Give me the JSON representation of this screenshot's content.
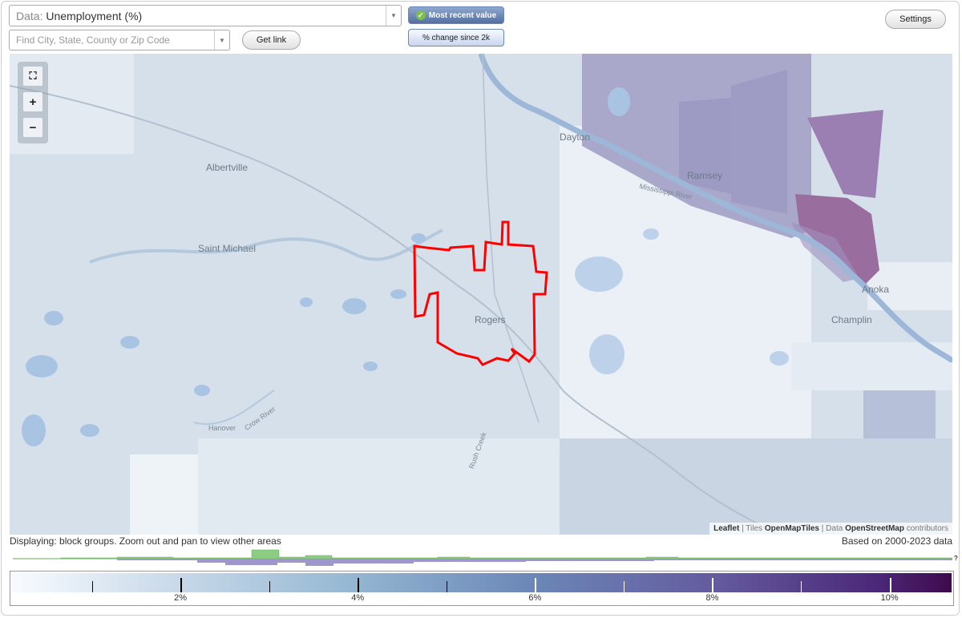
{
  "header": {
    "data_label": "Data:",
    "data_value": "Unemployment (%)",
    "search_placeholder": "Find City, State, County or Zip Code",
    "get_link": "Get link",
    "toggle_recent": "Most recent value",
    "toggle_change": "% change since 2k",
    "settings": "Settings"
  },
  "map": {
    "places": [
      "Dayton",
      "Albertville",
      "Ramsey",
      "Saint Michael",
      "Anoka",
      "Rogers",
      "Champlin",
      "Hanover",
      "Crow River",
      "Rush Creek",
      "Mississippi River"
    ],
    "attribution": {
      "leaflet": "Leaflet",
      "sep1": " | Tiles ",
      "tiles": "OpenMapTiles",
      "sep2": " | Data ",
      "data": "OpenStreetMap",
      "contrib": " contributors"
    },
    "zoom_controls": {
      "fit": "⛶",
      "in": "+",
      "out": "−"
    }
  },
  "footer": {
    "status": "Displaying: block groups. Zoom out and pan to view other areas",
    "based_on": "Based on 2000-2023 data",
    "hist_help": "?"
  },
  "legend": {
    "labels": [
      {
        "text": "2%",
        "value": 2
      },
      {
        "text": "4%",
        "value": 4
      },
      {
        "text": "6%",
        "value": 6
      },
      {
        "text": "8%",
        "value": 8
      },
      {
        "text": "10%",
        "value": 10
      }
    ],
    "min": 0.1,
    "max": 10.7,
    "minor_ticks": [
      1,
      3,
      5,
      7,
      9
    ]
  },
  "colors": {
    "accent": "#546f9f",
    "highlight": "#ff0000",
    "water": "#a9c4e2",
    "hist_green": "#8ccc83",
    "hist_purple": "#9d97cc"
  }
}
